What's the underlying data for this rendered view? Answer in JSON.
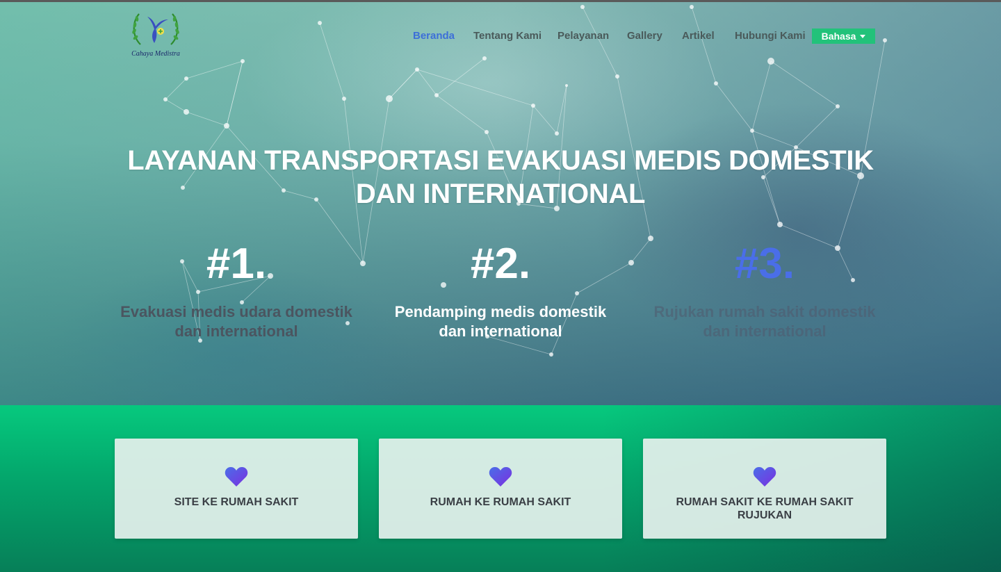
{
  "brand": {
    "name": "Cahaya Medistra",
    "logo_icon": "bird-laurel-logo-icon"
  },
  "nav": {
    "items": [
      {
        "label": "Beranda",
        "active": true
      },
      {
        "label": "Tentang Kami"
      },
      {
        "label": "Pelayanan"
      },
      {
        "label": "Gallery"
      },
      {
        "label": "Artikel"
      },
      {
        "label": "Hubungi Kami"
      }
    ],
    "language_button": "Bahasa"
  },
  "hero": {
    "headline_line1": "LAYANAN TRANSPORTASI EVAKUASI MEDIS DOMESTIK",
    "headline_line2": "DAN INTERNATIONAL",
    "features": [
      {
        "number": "#1.",
        "line1": "Evakuasi medis udara domestik",
        "line2": "dan international"
      },
      {
        "number": "#2.",
        "line1": "Pendamping medis domestik",
        "line2": "dan international"
      },
      {
        "number": "#3.",
        "line1": "Rujukan rumah sakit domestik",
        "line2": "dan international"
      }
    ]
  },
  "services": [
    {
      "icon": "heart-icon",
      "line1": "SITE KE RUMAH SAKIT",
      "line2": ""
    },
    {
      "icon": "heart-icon",
      "line1": "RUMAH KE RUMAH SAKIT",
      "line2": ""
    },
    {
      "icon": "heart-icon",
      "line1": "RUMAH SAKIT KE RUMAH SAKIT",
      "line2": "RUJUKAN"
    }
  ],
  "colors": {
    "nav_active": "#3d6fd8",
    "language_button_bg": "#22c27a",
    "section_green": "#06c97e",
    "feature3_number": "#4a6ee8",
    "heart_gradient_start": "#4a6ee8",
    "heart_gradient_end": "#7b2fe0"
  }
}
